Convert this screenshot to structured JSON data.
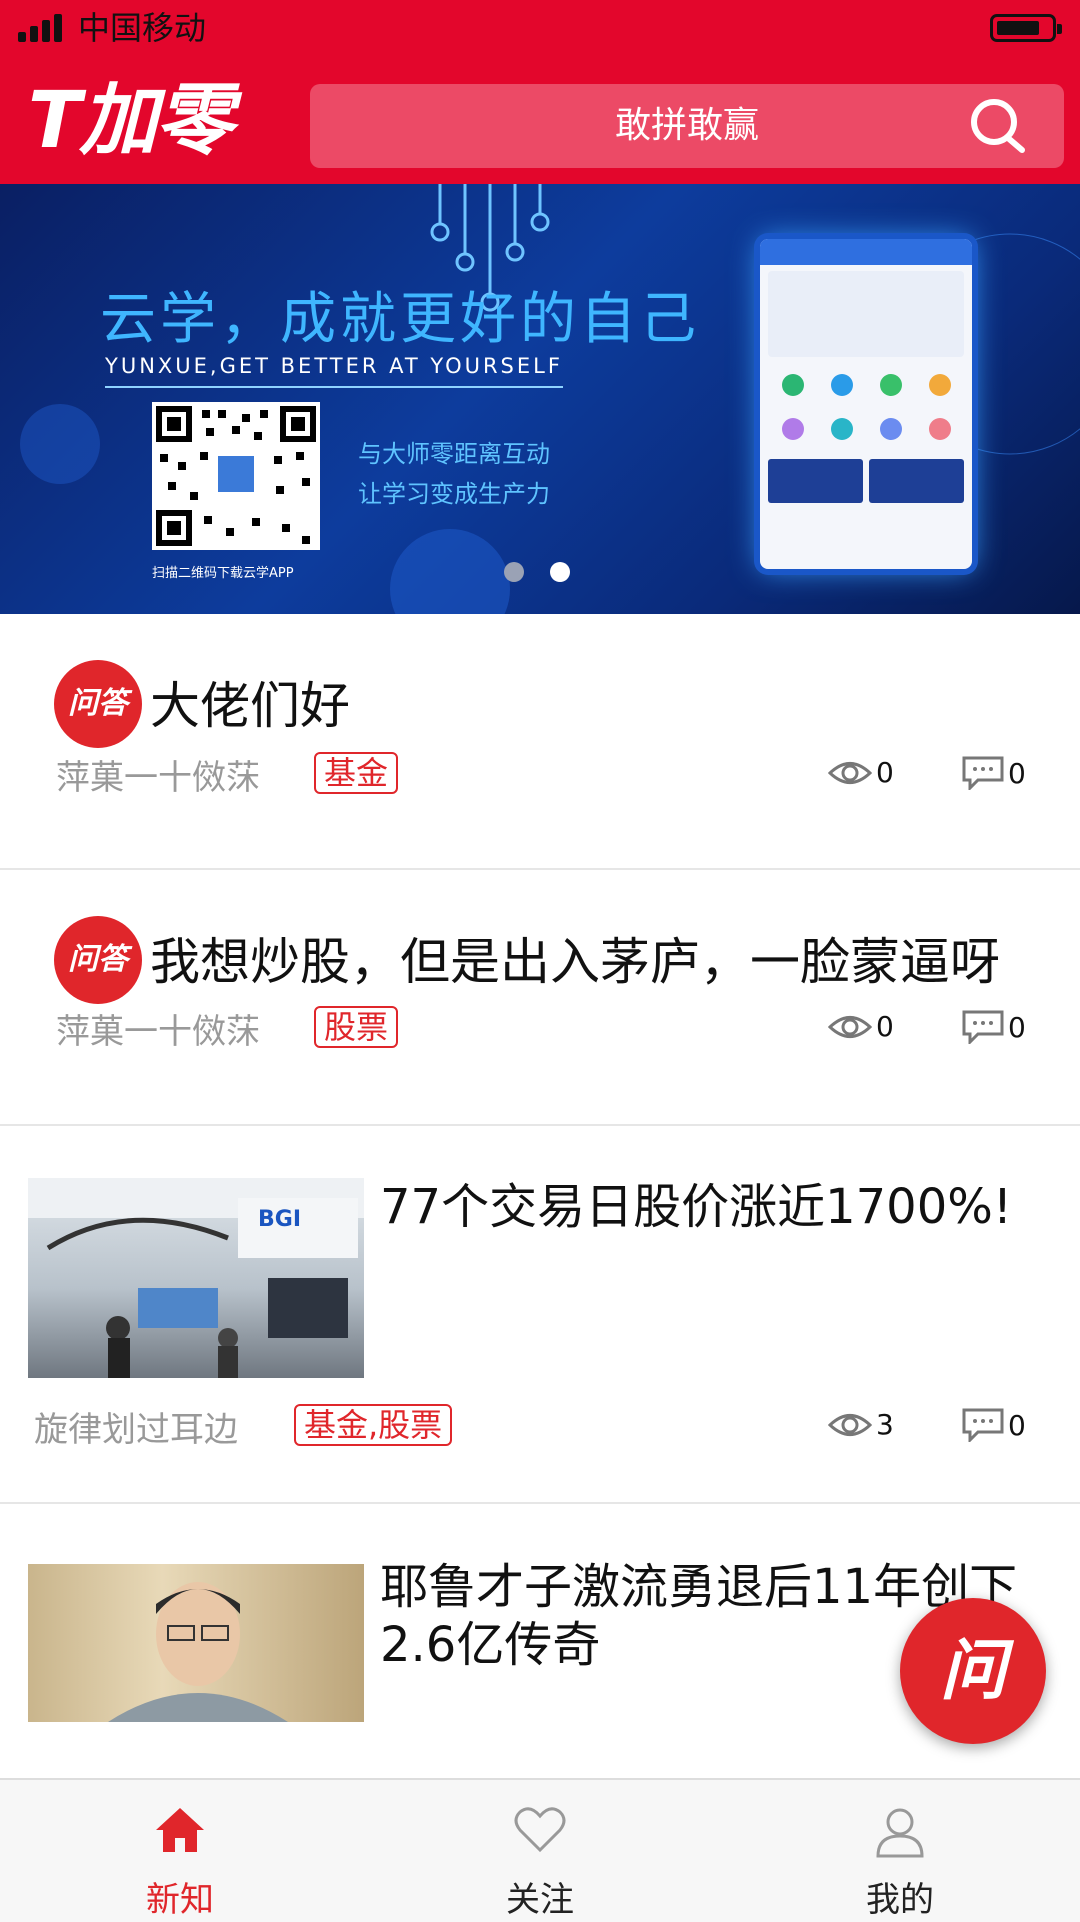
{
  "status_bar": {
    "carrier": "中国移动"
  },
  "header": {
    "logo": "T加零",
    "search_placeholder": "敢拼敢赢"
  },
  "banner": {
    "headline": "云学，成就更好的自己",
    "subline": "YUNXUE,GET BETTER AT YOURSELF",
    "slogan_1": "与大师零距离互动",
    "slogan_2": "让学习变成生产力",
    "qr_caption": "扫描二维码下载云学APP",
    "slide_count": 2,
    "active_slide": 2
  },
  "feed": [
    {
      "type": "qa",
      "badge": "问答",
      "title": "大佬们好",
      "author": "萍菓一十傚莯",
      "tag": "基金",
      "views": "0",
      "comments": "0"
    },
    {
      "type": "qa",
      "badge": "问答",
      "title": "我想炒股，但是出入茅庐，一脸蒙逼呀",
      "author": "萍菓一十傚莯",
      "tag": "股票",
      "views": "0",
      "comments": "0"
    },
    {
      "type": "article",
      "title": "77个交易日股价涨近1700%!",
      "author": "旋律划过耳边",
      "tag": "基金,股票",
      "views": "3",
      "comments": "0"
    },
    {
      "type": "article",
      "title": "耶鲁才子激流勇退后11年创下2.6亿传奇"
    }
  ],
  "fab": {
    "label": "问"
  },
  "tabs": [
    {
      "label": "新知",
      "icon": "home-icon",
      "active": true
    },
    {
      "label": "关注",
      "icon": "heart-icon",
      "active": false
    },
    {
      "label": "我的",
      "icon": "user-icon",
      "active": false
    }
  ],
  "colors": {
    "brand_red": "#e3062c",
    "tag_red": "#e0262b",
    "banner_blue": "#0d3c9d"
  }
}
